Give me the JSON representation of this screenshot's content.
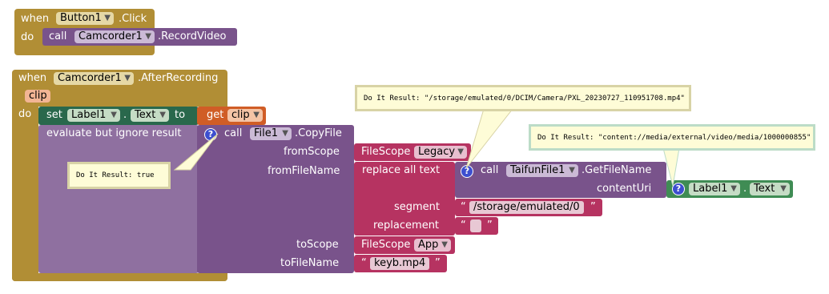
{
  "block1": {
    "when": "when",
    "component": "Button1",
    "event": ".Click",
    "do": "do",
    "call": "call",
    "call_component": "Camcorder1",
    "call_method": ".RecordVideo"
  },
  "block2": {
    "when": "when",
    "component": "Camcorder1",
    "event": ".AfterRecording",
    "param": "clip",
    "do": "do",
    "set": "set",
    "set_component": "Label1",
    "dot": ".",
    "set_property": "Text",
    "to": "to",
    "get": "get",
    "get_var": "clip",
    "evaluate": "evaluate but ignore result",
    "call": "call",
    "copy_component": "File1",
    "copy_method": ".CopyFile",
    "fromScope_label": "fromScope",
    "fromFileName_label": "fromFileName",
    "toScope_label": "toScope",
    "toFileName_label": "toFileName",
    "filescope": "FileScope",
    "scope_legacy": "Legacy",
    "scope_app": "App",
    "replace_all": "replace all text",
    "segment_label": "segment",
    "replacement_label": "replacement",
    "segment_value": "/storage/emulated/0",
    "replacement_value": "",
    "tofilename_value": "keyb.mp4",
    "taifun_call": "call",
    "taifun_component": "TaifunFile1",
    "taifun_method": ".GetFileName",
    "contentUri_label": "contentUri",
    "label_component": "Label1",
    "label_dot": ".",
    "label_property": "Text",
    "quote_open": "“",
    "quote_close": "”",
    "qmark": "?"
  },
  "bubbles": {
    "result_true": "Do It Result: true",
    "result_path": "Do It Result: \"/storage/emulated/0/DCIM/Camera/PXL_20230727_110951708.mp4\"",
    "result_uri": "Do It Result: \"content://media/external/video/media/1000000855\""
  },
  "colors": {
    "event": "#b18e35",
    "component_method": "#79538b",
    "setter": "#29684c",
    "variable": "#d05d26",
    "text": "#b63361",
    "getter": "#3f8c54",
    "bubble": "#fefcd7"
  },
  "icons": [
    "dropdown-arrow-icon",
    "help-question-icon"
  ]
}
